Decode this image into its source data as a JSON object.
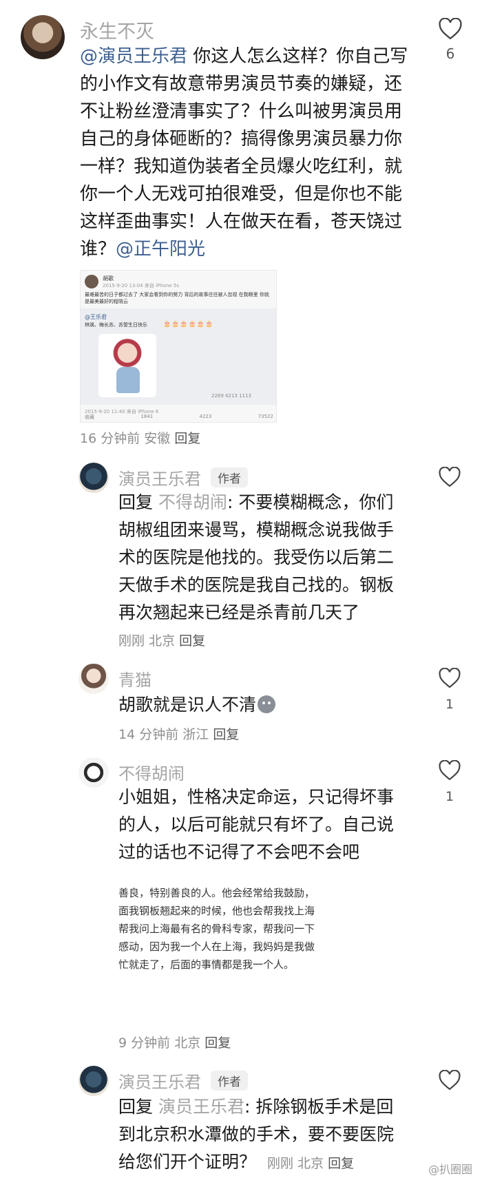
{
  "top_comment": {
    "username": "永生不灭",
    "mention": "@演员王乐君",
    "text": " 你这人怎么这样？你自己写的小作文有故意带男演员节奏的嫌疑，还不让粉丝澄清事实了？什么叫被男演员用自己的身体砸断的？搞得像男演员暴力你一样？我知道伪装者全员爆火吃红利，就你一个人无戏可拍很难受，但是你也不能这样歪曲事实！人在做天在看，苍天饶过谁？",
    "mention_end": "@正午阳光",
    "like_count": "6",
    "time": "16 分钟前",
    "location": "安徽",
    "reply_label": "回复",
    "screenshot": {
      "name": "胡歌",
      "time": "2015-9-20 13:04 来自 iPhone 5s",
      "body": "最难最苦的日子都过去了 大家会看到你的努力 背后的故事往往被人忽视 在我眼里 你就是最美最好的程晓云",
      "quote_name": "@王乐君",
      "quote_text": "林飒、梅长苏、苏誓生日快乐",
      "quote_emojis": "🎂🎂🎂🎂🎂🎂",
      "quote_stats": "2269  4213  1113",
      "foot_time": "2015-9-20 11:40 来自 iPhone 6",
      "foot_stats": [
        "收藏",
        "1841",
        "4223",
        "73522"
      ]
    }
  },
  "replies": [
    {
      "username": "演员王乐君",
      "badge": "作者",
      "prefix": "回复",
      "target": "不得胡闹",
      "text": ": 不要模糊概念，你们胡椒组团来谩骂，模糊概念说我做手术的医院是他找的。我受伤以后第二天做手术的医院是我自己找的。钢板再次翘起来已经是杀青前几天了",
      "time": "刚刚",
      "location": "北京",
      "reply_label": "回复"
    },
    {
      "username": "青猫",
      "text": "胡歌就是识人不清",
      "emoji": "sad-face",
      "like_count": "1",
      "time": "14 分钟前",
      "location": "浙江",
      "reply_label": "回复"
    },
    {
      "username": "不得胡闹",
      "text": "小姐姐，性格决定命运，只记得坏事的人，以后可能就只有坏了。自己说过的话也不记得了不会吧不会吧",
      "like_count": "1",
      "image_lines": [
        "善良，特别善良的人。他会经常给我鼓励，",
        "面我钢板翘起来的时候，他也会帮我找上海",
        "帮我问上海最有名的骨科专家，帮我问一下",
        "感动，因为我一个人在上海，我妈妈是我做",
        "忙就走了，后面的事情都是我一个人。"
      ],
      "time": "9 分钟前",
      "location": "北京",
      "reply_label": "回复"
    },
    {
      "username": "演员王乐君",
      "badge": "作者",
      "prefix": "回复",
      "target": "演员王乐君",
      "text": ": 拆除钢板手术是回到北京积水潭做的手术，要不要医院给您们开个证明？",
      "time": "刚刚",
      "location": "北京",
      "reply_label": "回复"
    }
  ],
  "watermark": "@扒圈圈"
}
